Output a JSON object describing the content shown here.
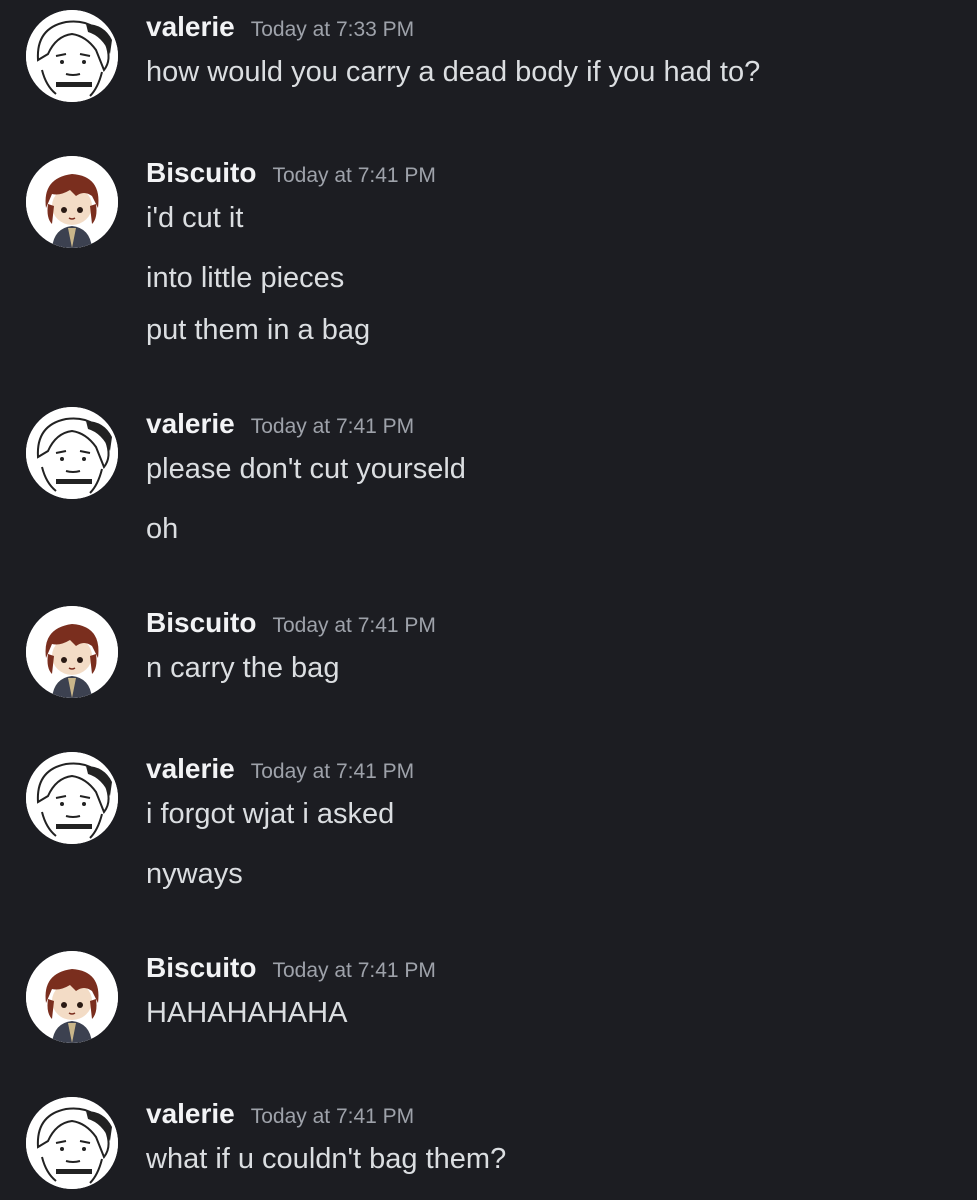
{
  "messages": [
    {
      "author": "valerie",
      "avatar": "valerie-avatar",
      "timestamp": "Today at 7:33 PM",
      "lines": [
        "how would you carry a dead body if you had to?"
      ]
    },
    {
      "author": "Biscuito",
      "avatar": "biscuito-avatar",
      "timestamp": "Today at 7:41 PM",
      "lines": [
        "i'd cut it",
        "into little pieces",
        "put them in a bag"
      ]
    },
    {
      "author": "valerie",
      "avatar": "valerie-avatar",
      "timestamp": "Today at 7:41 PM",
      "lines": [
        "please don't cut yourseld",
        "oh"
      ]
    },
    {
      "author": "Biscuito",
      "avatar": "biscuito-avatar",
      "timestamp": "Today at 7:41 PM",
      "lines": [
        "n carry the bag"
      ]
    },
    {
      "author": "valerie",
      "avatar": "valerie-avatar",
      "timestamp": "Today at 7:41 PM",
      "lines": [
        "i forgot wjat i asked",
        "nyways"
      ]
    },
    {
      "author": "Biscuito",
      "avatar": "biscuito-avatar",
      "timestamp": "Today at 7:41 PM",
      "lines": [
        "HAHAHAHAHA"
      ]
    },
    {
      "author": "valerie",
      "avatar": "valerie-avatar",
      "timestamp": "Today at 7:41 PM",
      "lines": [
        "what if u couldn't bag them?"
      ]
    }
  ]
}
